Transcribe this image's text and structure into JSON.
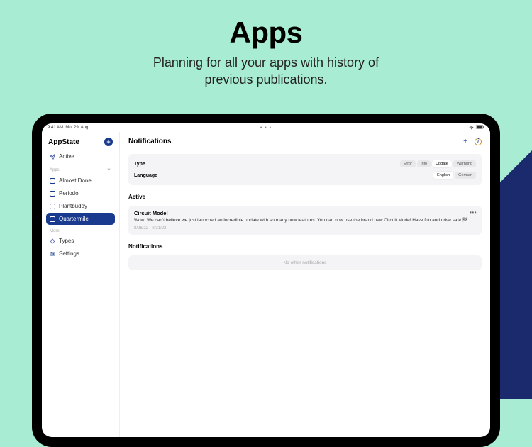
{
  "hero": {
    "title": "Apps",
    "subtitle_line1": "Planning for all your apps with history of",
    "subtitle_line2": "previous publications."
  },
  "status": {
    "time": "9:41 AM",
    "date": "Mo. 29. Aug.",
    "ellipsis": "• • •"
  },
  "sidebar": {
    "title": "AppState",
    "active_label": "Active",
    "section_apps": "Apps",
    "apps": [
      {
        "label": "Almost Done"
      },
      {
        "label": "Periodo"
      },
      {
        "label": "Plantbuddy"
      },
      {
        "label": "Quartermile"
      }
    ],
    "section_more": "More",
    "types_label": "Types",
    "settings_label": "Settings"
  },
  "main": {
    "title": "Notifications",
    "filters": {
      "type_label": "Type",
      "language_label": "Language",
      "types": [
        "Error",
        "Info",
        "Update",
        "Warnung"
      ],
      "languages": [
        "English",
        "German"
      ]
    },
    "active_heading": "Active",
    "notif": {
      "title": "Circuit Mode!",
      "body": "Wow! We can't believe we just launched an incredible update with so many new features. You can now use the brand new Circuit Mode! Have fun and drive safe 🏁",
      "date": "8/26/22 - 8/31/22"
    },
    "notifications_heading": "Notifications",
    "empty_text": "No other notifications"
  }
}
